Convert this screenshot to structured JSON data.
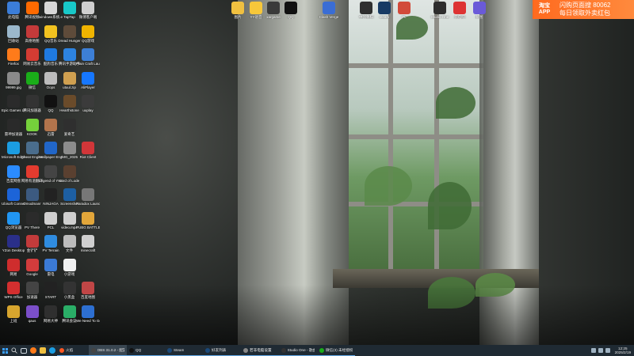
{
  "desktop": {
    "icons_left": [
      {
        "label": "此电脑",
        "icon": "computer-icon",
        "color": "#3b7dd8",
        "col": 0,
        "row": 0
      },
      {
        "label": "腾讯视频",
        "icon": "tencent-video-icon",
        "color": "#ff6a00",
        "col": 1,
        "row": 0
      },
      {
        "label": "windows系统.exe",
        "icon": "file-icon",
        "color": "#d7d7d7",
        "col": 2,
        "row": 0
      },
      {
        "label": "TapTap",
        "icon": "taptap-icon",
        "color": "#18c8c8",
        "col": 3,
        "row": 0
      },
      {
        "label": "微博客户端",
        "icon": "file-icon",
        "color": "#cfcfcf",
        "col": 4,
        "row": 0
      },
      {
        "label": "回收站",
        "icon": "recycle-bin-icon",
        "color": "#9bb8cc",
        "col": 0,
        "row": 1
      },
      {
        "label": "高德地图",
        "icon": "map-icon",
        "color": "#c43a3a",
        "col": 1,
        "row": 1
      },
      {
        "label": "QQ音乐",
        "icon": "music-icon",
        "color": "#f2c21f",
        "col": 2,
        "row": 1
      },
      {
        "label": "Dread Hunger",
        "icon": "game-icon",
        "color": "#5e4b3a",
        "col": 3,
        "row": 1
      },
      {
        "label": "QQ游戏",
        "icon": "game-icon",
        "color": "#f0b400",
        "col": 4,
        "row": 1
      },
      {
        "label": "Firefox",
        "icon": "firefox-icon",
        "color": "#ff7b1a",
        "col": 0,
        "row": 2
      },
      {
        "label": "网易云音乐",
        "icon": "music-icon",
        "color": "#d43c33",
        "col": 1,
        "row": 2
      },
      {
        "label": "酷狗音乐",
        "icon": "music-icon",
        "color": "#1f7ae0",
        "col": 2,
        "row": 2
      },
      {
        "label": "腾讯手游助手",
        "icon": "game-icon",
        "color": "#2d83e0",
        "col": 3,
        "row": 2
      },
      {
        "label": "Plain Craft Launcher",
        "icon": "game-icon",
        "color": "#3d7fd6",
        "col": 4,
        "row": 2
      },
      {
        "label": "99999.jpg",
        "icon": "image-icon",
        "color": "#8a8a8a",
        "col": 0,
        "row": 3
      },
      {
        "label": "微信",
        "icon": "wechat-icon",
        "color": "#1aad19",
        "col": 1,
        "row": 3
      },
      {
        "label": "Oops",
        "icon": "file-icon",
        "color": "#bcbcbc",
        "col": 2,
        "row": 3
      },
      {
        "label": "utuul.zip",
        "icon": "zip-icon",
        "color": "#d0a050",
        "col": 3,
        "row": 3
      },
      {
        "label": "AliPlayer",
        "icon": "player-icon",
        "color": "#1677ff",
        "col": 4,
        "row": 3
      },
      {
        "label": "Epic Games Launcher",
        "icon": "epic-icon",
        "color": "#2b2b2b",
        "col": 0,
        "row": 4
      },
      {
        "label": "腾讯加速器",
        "icon": "game-icon",
        "color": "#333",
        "col": 1,
        "row": 4
      },
      {
        "label": "QQ",
        "icon": "qq-icon",
        "color": "#111",
        "col": 2,
        "row": 4
      },
      {
        "label": "Hearthstone",
        "icon": "game-icon",
        "color": "#6a4b2a",
        "col": 3,
        "row": 4
      },
      {
        "label": "uuplay",
        "icon": "game-icon",
        "color": "#3b3b3b",
        "col": 4,
        "row": 4
      },
      {
        "label": "雷神加速器",
        "icon": "game-icon",
        "color": "#2a2a2a",
        "col": 0,
        "row": 5
      },
      {
        "label": "KOOK",
        "icon": "kook-icon",
        "color": "#75d13b",
        "col": 1,
        "row": 5
      },
      {
        "label": "迅雷",
        "icon": "game-icon",
        "color": "#b2744c",
        "col": 2,
        "row": 5
      },
      {
        "label": "爱奇艺",
        "icon": "video-icon",
        "color": "#2f2f2f",
        "col": 3,
        "row": 5
      },
      {
        "label": "Microsoft Edge",
        "icon": "edge-icon",
        "color": "#1b9de2",
        "col": 0,
        "row": 6
      },
      {
        "label": "Cheat Engine",
        "icon": "cheat-engine-icon",
        "color": "#4a6d8c",
        "col": 1,
        "row": 6
      },
      {
        "label": "Wallpaper Engine",
        "icon": "wallpaper-icon",
        "color": "#2166c8",
        "col": 2,
        "row": 6
      },
      {
        "label": "IMG_2025",
        "icon": "image-icon",
        "color": "#8c8c8c",
        "col": 3,
        "row": 6
      },
      {
        "label": "Riot Client",
        "icon": "riot-icon",
        "color": "#d13639",
        "col": 4,
        "row": 6
      },
      {
        "label": "百度网盘",
        "icon": "cloud-icon",
        "color": "#2b8cff",
        "col": 0,
        "row": 7
      },
      {
        "label": "网易有道翻译",
        "icon": "app-icon",
        "color": "#e33b2f",
        "col": 1,
        "row": 7
      },
      {
        "label": "Legend of YMIR",
        "icon": "game-icon",
        "color": "#444",
        "col": 2,
        "row": 7
      },
      {
        "label": "Lord of Lode",
        "icon": "game-icon",
        "color": "#5a4030",
        "col": 3,
        "row": 7
      },
      {
        "label": "Ubisoft Connect",
        "icon": "ubisoft-icon",
        "color": "#1c64d8",
        "col": 0,
        "row": 8
      },
      {
        "label": "Omodmanr",
        "icon": "app-icon",
        "color": "#3c5a80",
        "col": 1,
        "row": 8
      },
      {
        "label": "NINJAGA",
        "icon": "game-icon",
        "color": "#222",
        "col": 2,
        "row": 8
      },
      {
        "label": "Screenshot",
        "icon": "app-icon",
        "color": "#1d5fa3",
        "col": 3,
        "row": 8
      },
      {
        "label": "Paradox Launcher",
        "icon": "paradox-icon",
        "color": "#777",
        "col": 4,
        "row": 8
      },
      {
        "label": "QQ浏览器",
        "icon": "browser-icon",
        "color": "#2196f3",
        "col": 0,
        "row": 9
      },
      {
        "label": "PV There",
        "icon": "app-icon",
        "color": "#2b2b2b",
        "col": 1,
        "row": 9
      },
      {
        "label": "PCL",
        "icon": "file-icon",
        "color": "#cfcfcf",
        "col": 2,
        "row": 9
      },
      {
        "label": "video.mp4",
        "icon": "file-icon",
        "color": "#cfcfcf",
        "col": 3,
        "row": 9
      },
      {
        "label": "PUBG BATTLEGROUNDS",
        "icon": "game-icon",
        "color": "#e2a63a",
        "col": 4,
        "row": 9
      },
      {
        "label": "YZon Desktop",
        "icon": "app-icon",
        "color": "#2a2f89",
        "col": 0,
        "row": 10
      },
      {
        "label": "金铲铲",
        "icon": "game-icon",
        "color": "#c23b3b",
        "col": 1,
        "row": 10
      },
      {
        "label": "PV Terrain",
        "icon": "app-icon",
        "color": "#2f8ce0",
        "col": 2,
        "row": 10
      },
      {
        "label": "文件",
        "icon": "file-icon",
        "color": "#bcbcbc",
        "col": 3,
        "row": 10
      },
      {
        "label": "minecraft",
        "icon": "file-icon",
        "color": "#cfcfcf",
        "col": 4,
        "row": 10
      },
      {
        "label": "网易",
        "icon": "app-icon",
        "color": "#cf2d2d",
        "col": 0,
        "row": 11
      },
      {
        "label": "Google",
        "icon": "app-icon",
        "color": "#d23c3c",
        "col": 1,
        "row": 11
      },
      {
        "label": "雷电",
        "icon": "app-icon",
        "color": "#3b7ad6",
        "col": 2,
        "row": 11
      },
      {
        "label": "小游戏",
        "icon": "app-icon",
        "color": "#f0f0f0",
        "col": 3,
        "row": 11
      },
      {
        "label": "WPS Office",
        "icon": "wps-icon",
        "color": "#d32f2f",
        "col": 0,
        "row": 12
      },
      {
        "label": "加速器",
        "icon": "app-icon",
        "color": "#444",
        "col": 1,
        "row": 12
      },
      {
        "label": "START",
        "icon": "app-icon",
        "color": "#222",
        "col": 2,
        "row": 12
      },
      {
        "label": "小黑盒",
        "icon": "app-icon",
        "color": "#333",
        "col": 3,
        "row": 12
      },
      {
        "label": "百度地图",
        "icon": "app-icon",
        "color": "#c04646",
        "col": 4,
        "row": 12
      },
      {
        "label": "上班",
        "icon": "app-icon",
        "color": "#d7a52e",
        "col": 0,
        "row": 13
      },
      {
        "label": "qaus",
        "icon": "app-icon",
        "color": "#7b4fc9",
        "col": 1,
        "row": 13
      },
      {
        "label": "网易大神",
        "icon": "app-icon",
        "color": "#2f2f2f",
        "col": 2,
        "row": 13
      },
      {
        "label": "腾讯会议",
        "icon": "app-icon",
        "color": "#2aae67",
        "col": 3,
        "row": 13
      },
      {
        "label": "We Need To Go",
        "icon": "app-icon",
        "color": "#2d6fd1",
        "col": 4,
        "row": 13
      }
    ],
    "icons_top": [
      {
        "label": "图片",
        "icon": "folder-icon",
        "color": "#f0c040"
      },
      {
        "label": "YY语音",
        "icon": "yy-icon",
        "color": "#f7c73a"
      },
      {
        "label": "xargame",
        "icon": "game-icon",
        "color": "#3a3a3a"
      },
      {
        "label": "QQ",
        "icon": "qq-icon",
        "color": "#111"
      },
      {
        "label": "Clash Verge",
        "icon": "app-icon",
        "color": "#3a6dd4"
      },
      {
        "label": "中国象棋",
        "icon": "app-icon",
        "color": "#2f2f2f"
      },
      {
        "label": "steam",
        "icon": "steam-icon",
        "color": "#173a64"
      },
      {
        "label": "PL",
        "icon": "app-icon",
        "color": "#d24a3a"
      },
      {
        "label": "Studio One",
        "icon": "app-icon",
        "color": "#2d2d2d"
      },
      {
        "label": "云电脑",
        "icon": "app-icon",
        "color": "#d33"
      },
      {
        "label": "截图",
        "icon": "app-icon",
        "color": "#6a5ad8"
      }
    ]
  },
  "ad": {
    "brand": "淘宝\nAPP",
    "line1": "闪购页面搜 80062",
    "line2": "每日领取外卖红包"
  },
  "taskbar": {
    "apps": [
      {
        "label": "火焰",
        "color": "#ff5722",
        "active": false
      },
      {
        "label": "OBS 31.0.2 - 配置",
        "color": "#444",
        "active": true
      },
      {
        "label": "QQ",
        "color": "#111",
        "active": false
      },
      {
        "label": "Steam",
        "color": "#1b4a7a",
        "active": false
      },
      {
        "label": "好友列表",
        "color": "#1b4a7a",
        "active": false
      },
      {
        "label": "若非电脑设置",
        "color": "#888",
        "active": false
      },
      {
        "label": "Studio One - 歌曲",
        "color": "#333",
        "active": false
      },
      {
        "label": "微信(3) 未经授权",
        "color": "#1aad19",
        "active": false
      }
    ],
    "time": "12:25",
    "date": "2025/2/19"
  }
}
